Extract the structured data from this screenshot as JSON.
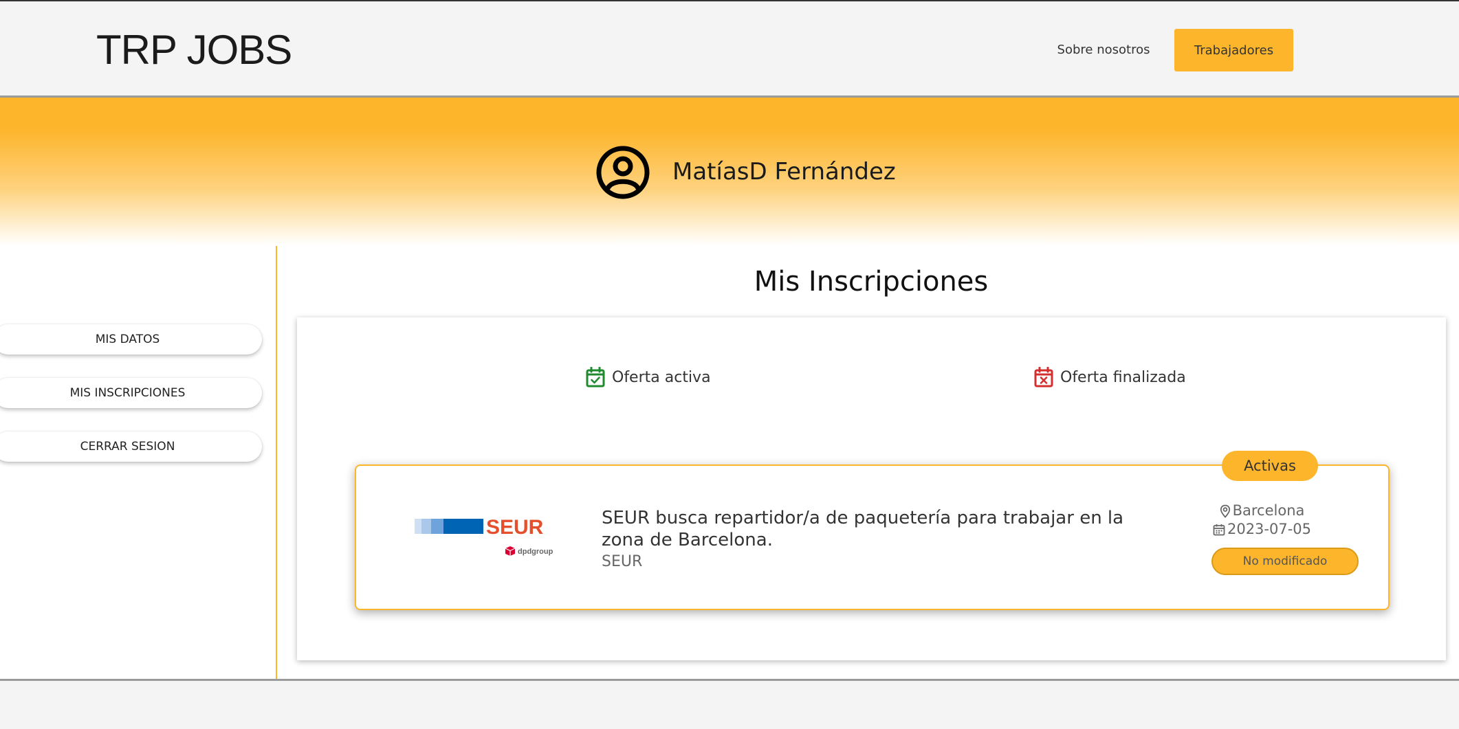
{
  "header": {
    "logo": "TRP JOBS",
    "nav": {
      "about_label": "Sobre nosotros",
      "workers_label": "Trabajadores"
    }
  },
  "profile": {
    "name": "MatíasD Fernández"
  },
  "sidebar": {
    "items": [
      {
        "label": "MIS DATOS"
      },
      {
        "label": "MIS INSCRIPCIONES"
      },
      {
        "label": "CERRAR SESION"
      }
    ]
  },
  "main": {
    "title": "Mis Inscripciones",
    "legend": {
      "active_label": "Oferta activa",
      "ended_label": "Oferta finalizada"
    },
    "offers": [
      {
        "badge": "Activas",
        "logo_text": "SEUR",
        "logo_subtext": "dpdgroup",
        "title": "SEUR busca repartidor/a de paquetería para trabajar en la zona de Barcelona.",
        "company": "SEUR",
        "location": "Barcelona",
        "date": "2023-07-05",
        "status": "No modificado"
      }
    ]
  },
  "colors": {
    "accent": "#fdb52c",
    "active_icon": "#1f8a2e",
    "ended_icon": "#d32f2f",
    "seur_red": "#e4502b",
    "seur_blue": "#0064b4",
    "dpd_red": "#dc0032"
  },
  "icons": {
    "avatar": "user-circle-icon",
    "active": "calendar-check-icon",
    "ended": "calendar-x-icon",
    "location": "map-pin-icon",
    "date": "calendar-icon"
  }
}
